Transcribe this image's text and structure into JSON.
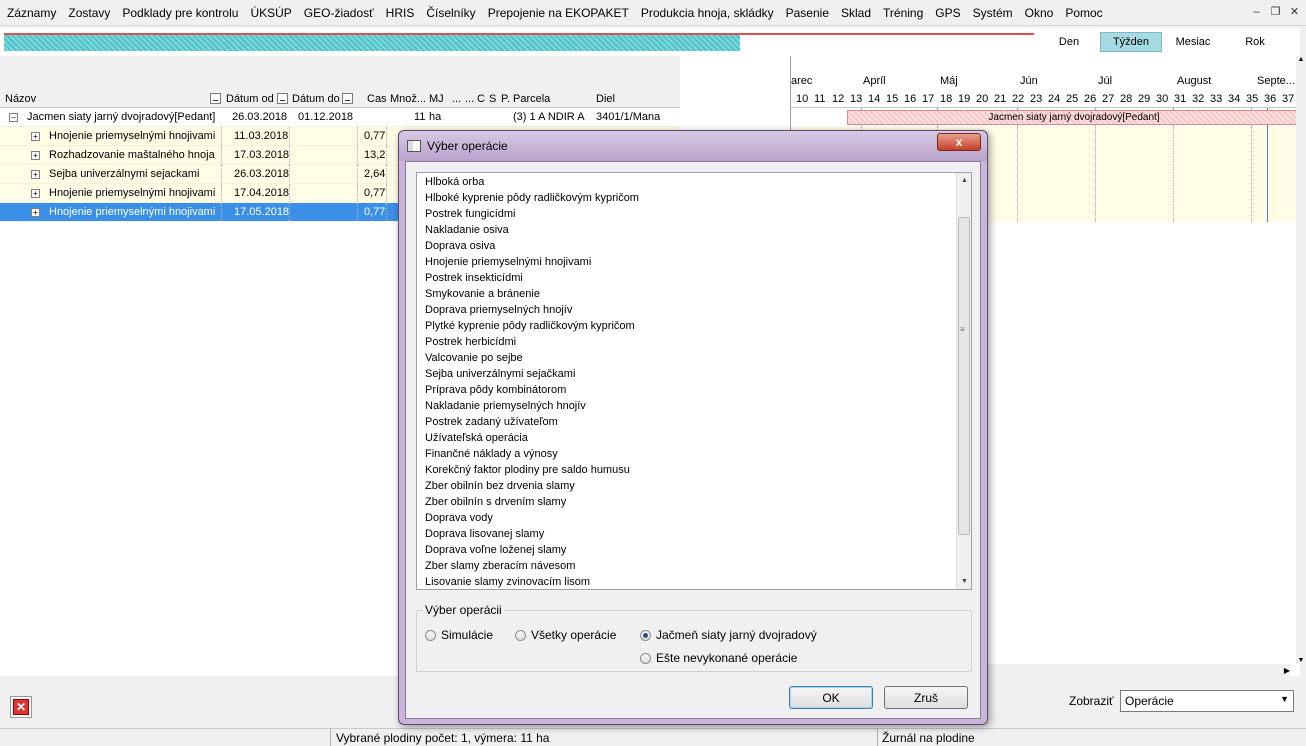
{
  "menu": [
    "Záznamy",
    "Zostavy",
    "Podklady pre kontrolu",
    "ÚKSÚP",
    "GEO-žiadosť",
    "HRIS",
    "Číselníky",
    "Prepojenie na EKOPAKET",
    "Produkcia hnoja, skládky",
    "Pasenie",
    "Sklad",
    "Tréning",
    "GPS",
    "Systém",
    "Okno",
    "Pomoc"
  ],
  "progress": {
    "fraction": 0.715
  },
  "view_buttons": [
    {
      "label": "Den",
      "active": false
    },
    {
      "label": "Týžden",
      "active": true
    },
    {
      "label": "Mesiac",
      "active": false
    },
    {
      "label": "Rok",
      "active": false
    }
  ],
  "columns": {
    "nazov": "Názov",
    "datum_od": "Dátum od",
    "datum_do": "Dátum do",
    "cas": "Cas",
    "mnoz": "Množ...",
    "mj": "MJ",
    "dots": "...",
    "dots2": "...",
    "c": "C",
    "s": "S",
    "p": "P.",
    "parcela": "Parcela",
    "diel": "Diel"
  },
  "parent_row": {
    "nazov": "Jacmen siaty jarný dvojradový[Pedant]",
    "datum_od": "26.03.2018",
    "datum_do": "01.12.2018",
    "mnoz": "11",
    "mj": "ha",
    "parcela": "(3) 1 A NDIR A",
    "diel": "3401/1/Mana"
  },
  "child_rows": [
    {
      "nazov": "Hnojenie priemyselnými hnojivami",
      "datum_od": "11.03.2018",
      "cas": "0,77"
    },
    {
      "nazov": "Rozhadzovanie maštalného hnoja",
      "datum_od": "17.03.2018",
      "cas": "13,2"
    },
    {
      "nazov": "Sejba univerzálnymi sejackami",
      "datum_od": "26.03.2018",
      "cas": "2,64"
    },
    {
      "nazov": "Hnojenie priemyselnými hnojivami",
      "datum_od": "17.04.2018",
      "cas": "0,77"
    },
    {
      "nazov": "Hnojenie priemyselnými hnojivami",
      "datum_od": "17.05.2018",
      "cas": "0,77",
      "selected": true
    }
  ],
  "gantt": {
    "months": [
      "arec",
      "Apríl",
      "Máj",
      "Jún",
      "Júl",
      "August",
      "Septe..."
    ],
    "weeks": [
      "10",
      "11",
      "12",
      "13",
      "14",
      "15",
      "16",
      "17",
      "18",
      "19",
      "20",
      "21",
      "22",
      "23",
      "24",
      "25",
      "26",
      "27",
      "28",
      "29",
      "30",
      "31",
      "32",
      "33",
      "34",
      "35",
      "36",
      "37"
    ],
    "bar_label": "Jacmen siaty jarný dvojradový[Pedant]"
  },
  "dialog": {
    "title": "Výber operácie",
    "close_label": "x",
    "operations": [
      "Hlboká orba",
      "Hlboké kyprenie pôdy radličkovým kypričom",
      "Postrek fungicídmi",
      "Nakladanie osiva",
      "Doprava osiva",
      "Hnojenie priemyselnými hnojivami",
      "Postrek insekticídmi",
      "Smykovanie a bránenie",
      "Doprava priemyselných hnojív",
      "Plytké kyprenie pôdy radličkovým kypričom",
      "Postrek herbicídmi",
      "Valcovanie po sejbe",
      "Sejba univerzálnymi sejačkami",
      "Príprava pôdy kombinátorom",
      "Nakladanie priemyselných hnojív",
      "Postrek zadaný užívateľom",
      "Užívateľská operácia",
      "Finančné náklady a výnosy",
      "Korekčný faktor plodiny pre saldo humusu",
      "Zber obilnín bez drvenia slamy",
      "Zber obilnín s drvením slamy",
      "Doprava vody",
      "Doprava lisovanej slamy",
      "Doprava voľne loženej slamy",
      "Zber slamy zberacím návesom",
      "Lisovanie slamy zvinovacím lisom"
    ],
    "group_label": "Výber operácii",
    "radios": [
      {
        "label": "Simulácie",
        "checked": false
      },
      {
        "label": "Všetky operácie",
        "checked": false
      },
      {
        "label": "Jačmeň siaty jarný dvojradový",
        "checked": true
      },
      {
        "label": "Ešte nevykonané operácie",
        "checked": false
      }
    ],
    "ok_label": "OK",
    "cancel_label": "Zruš"
  },
  "bottom": {
    "zobrazit_label": "Zobraziť",
    "zobrazit_value": "Operácie"
  },
  "status": {
    "left": "Vybrané plodiny počet: 1, výmera:  11 ha",
    "right": "Žurnál na plodine"
  }
}
